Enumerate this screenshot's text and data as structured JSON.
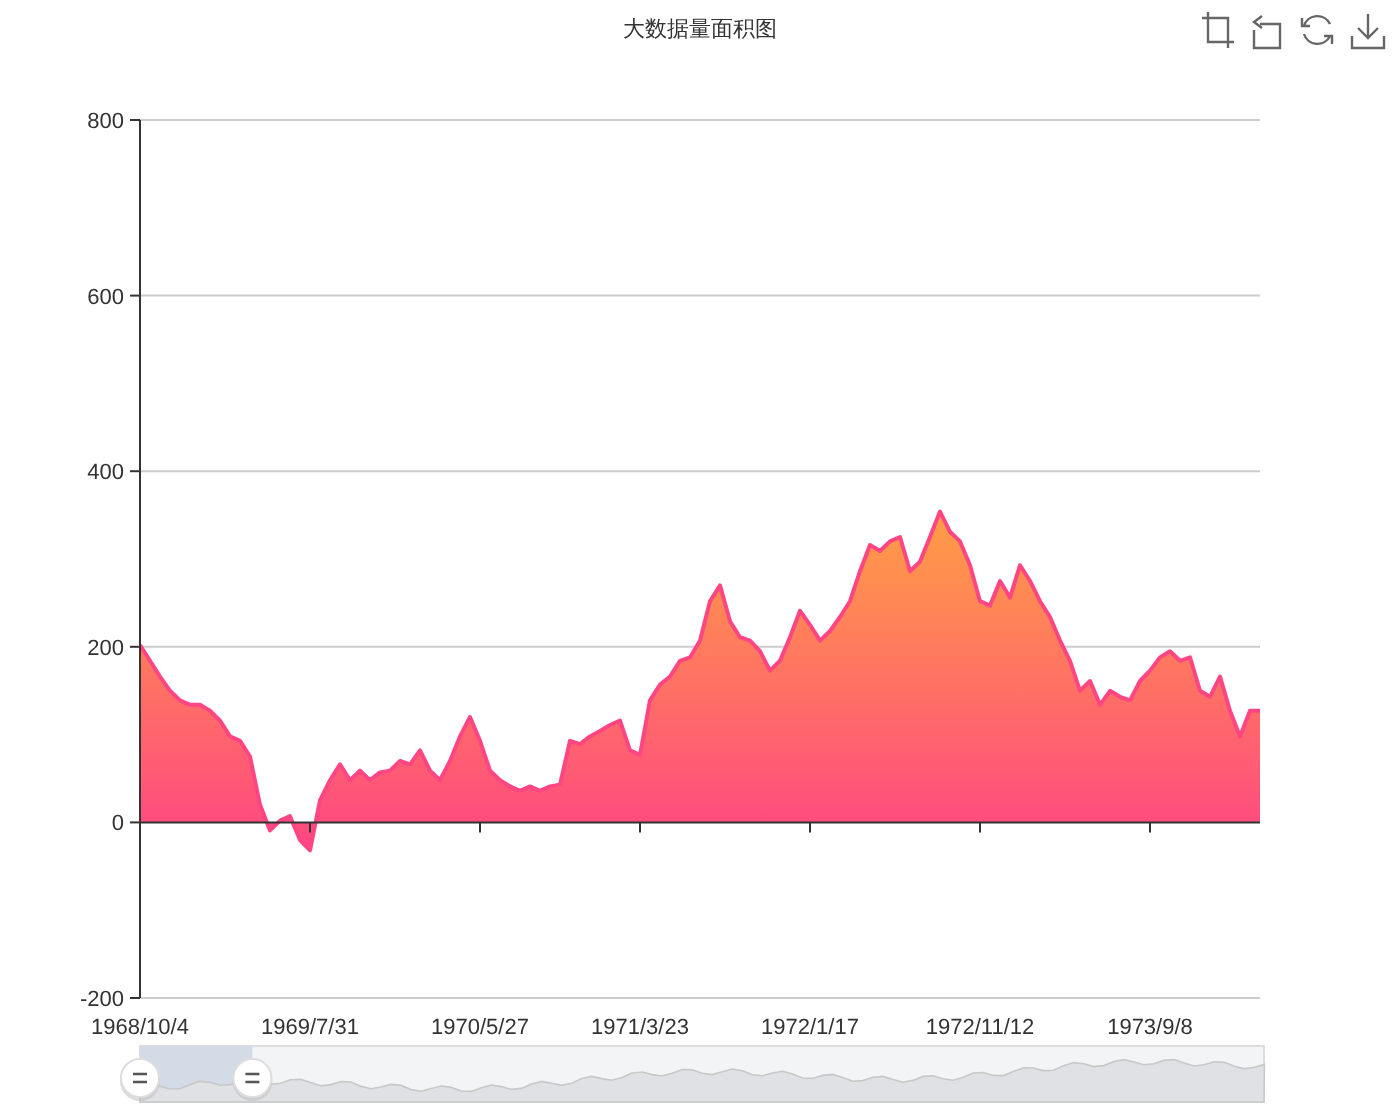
{
  "title": "大数据量面积图",
  "toolbox": [
    {
      "kind": "zoom"
    },
    {
      "kind": "back"
    },
    {
      "kind": "restore"
    },
    {
      "kind": "save"
    }
  ],
  "chart": {
    "chart_data": {
      "type": "area",
      "grid": true,
      "ylim": [
        -200,
        800
      ],
      "yticks": [
        -200,
        0,
        200,
        400,
        600,
        800
      ],
      "categories": [
        "1968/10/4",
        null,
        null,
        null,
        null,
        null,
        null,
        null,
        null,
        null,
        null,
        null,
        null,
        null,
        null,
        null,
        null,
        "1969/7/31",
        null,
        null,
        null,
        null,
        null,
        null,
        null,
        null,
        null,
        null,
        null,
        null,
        null,
        null,
        null,
        null,
        "1970/5/27",
        null,
        null,
        null,
        null,
        null,
        null,
        null,
        null,
        null,
        null,
        null,
        null,
        null,
        null,
        null,
        "1971/3/23",
        null,
        null,
        null,
        null,
        null,
        null,
        null,
        null,
        null,
        null,
        null,
        null,
        null,
        null,
        null,
        null,
        "1972/1/17",
        null,
        null,
        null,
        null,
        null,
        null,
        null,
        null,
        null,
        null,
        null,
        null,
        null,
        null,
        null,
        null,
        "1972/11/12",
        null,
        null,
        null,
        null,
        null,
        null,
        null,
        null,
        null,
        null,
        null,
        null,
        null,
        null,
        null,
        null,
        "1973/9/8",
        null,
        null,
        null,
        null,
        null,
        null,
        null,
        null,
        null,
        null,
        null
      ],
      "series": [
        {
          "color": "#ff4683",
          "values": [
            202,
            184,
            166,
            150,
            139,
            134,
            134,
            127,
            116,
            98,
            93,
            75,
            20,
            -9,
            2,
            7,
            -20,
            -32,
            25,
            48,
            66,
            48,
            59,
            48,
            57,
            59,
            70,
            66,
            82,
            59,
            48,
            70,
            98,
            120,
            93,
            59,
            48,
            41,
            36,
            41,
            36,
            41,
            43,
            93,
            89,
            98,
            104,
            111,
            116,
            82,
            77,
            139,
            157,
            166,
            184,
            188,
            207,
            252,
            270,
            229,
            211,
            207,
            195,
            173,
            184,
            211,
            241,
            225,
            207,
            218,
            234,
            252,
            286,
            316,
            309,
            320,
            325,
            286,
            297,
            325,
            354,
            331,
            320,
            293,
            252,
            247,
            275,
            256,
            293,
            275,
            252,
            234,
            207,
            184,
            150,
            161,
            134,
            150,
            143,
            139,
            161,
            173,
            188,
            195,
            184,
            188,
            150,
            143,
            166,
            127,
            98,
            127,
            127
          ]
        }
      ]
    }
  },
  "data_zoom": {
    "handles": [
      {
        "level": 0
      },
      {
        "level": 0.1
      }
    ]
  }
}
